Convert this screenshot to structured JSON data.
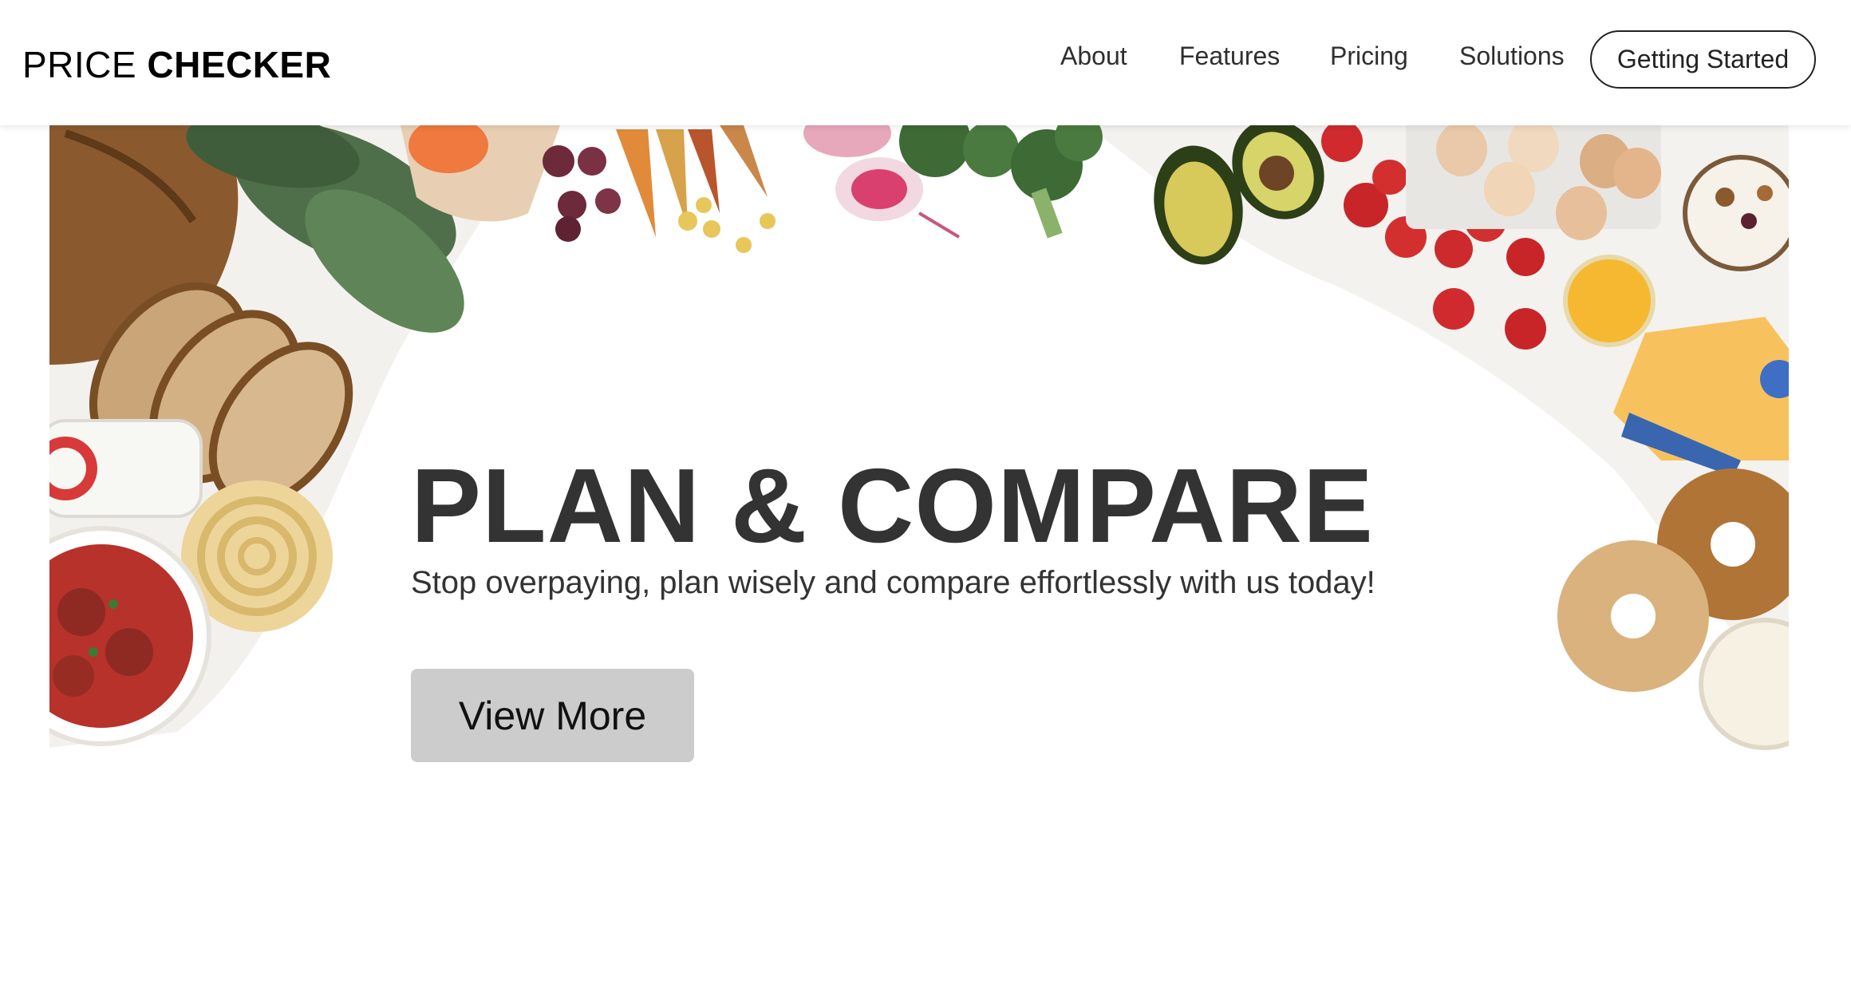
{
  "brand": {
    "light": "PRICE ",
    "bold": "CHECKER"
  },
  "nav": {
    "items": [
      {
        "label": "About"
      },
      {
        "label": "Features"
      },
      {
        "label": "Pricing"
      },
      {
        "label": "Solutions"
      }
    ],
    "cta_label": "Getting Started"
  },
  "hero": {
    "title": "PLAN & COMPARE",
    "subtitle": "Stop overpaying, plan wisely and compare effortlessly with us today!",
    "button_label": "View More",
    "image_subject": "groceries-flatlay"
  },
  "colors": {
    "text": "#333333",
    "button_bg": "#cccccc",
    "header_bg": "#ffffff"
  }
}
